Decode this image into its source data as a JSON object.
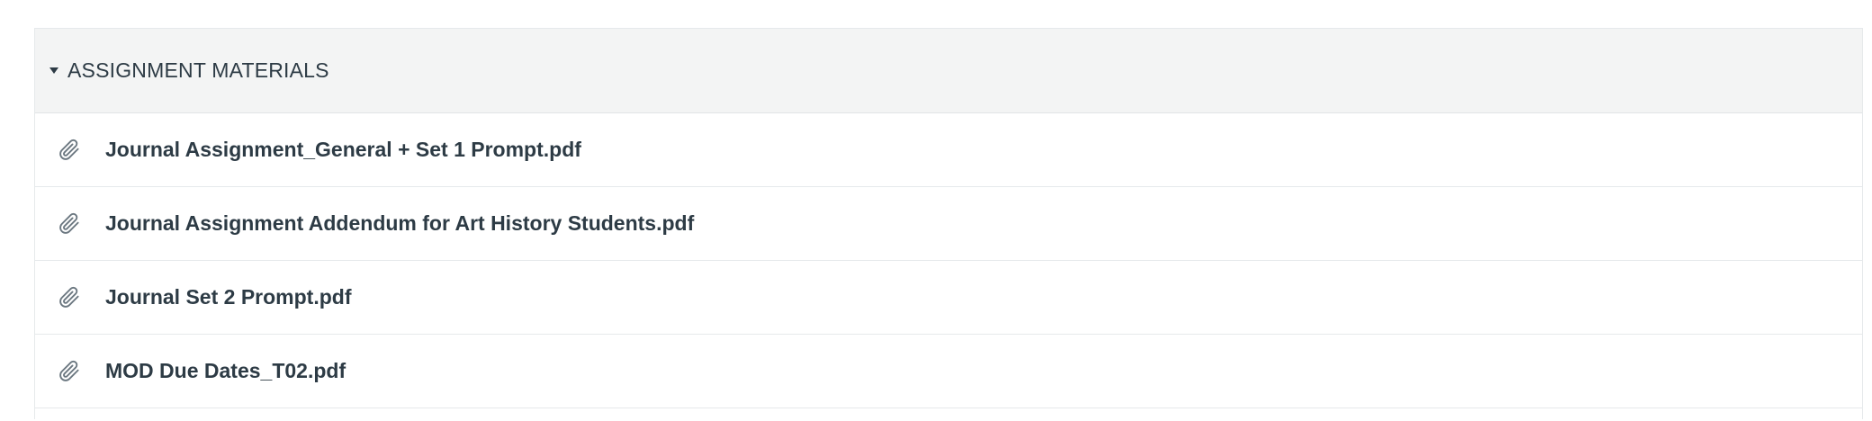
{
  "module": {
    "title": "ASSIGNMENT MATERIALS",
    "items": [
      {
        "label": "Journal Assignment_General + Set 1 Prompt.pdf",
        "icon": "paperclip-icon"
      },
      {
        "label": "Journal Assignment Addendum for Art History Students.pdf",
        "icon": "paperclip-icon"
      },
      {
        "label": "Journal Set 2 Prompt.pdf",
        "icon": "paperclip-icon"
      },
      {
        "label": "MOD Due Dates_T02.pdf",
        "icon": "paperclip-icon"
      }
    ]
  },
  "colors": {
    "header_bg": "#f3f4f4",
    "text": "#2d3b45",
    "icon": "#6b7780",
    "border": "#e6e9eb"
  }
}
